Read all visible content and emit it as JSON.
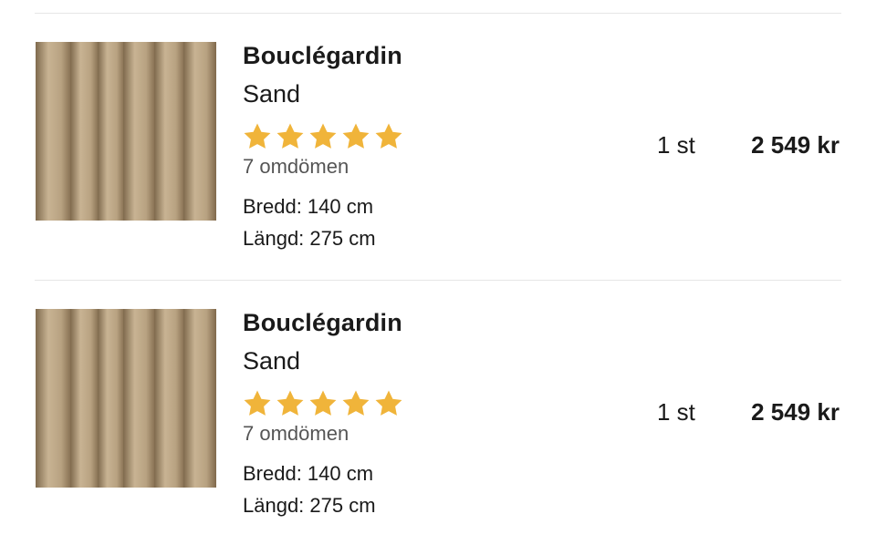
{
  "colors": {
    "star": "#f0b43a",
    "divider": "#e6e6e6",
    "text": "#1a1a1a",
    "muted": "#555555",
    "fabric": "#b39d7d"
  },
  "cart": {
    "items": [
      {
        "image_icon": "curtain-fabric-thumbnail",
        "name": "Bouclégardin",
        "variant": "Sand",
        "rating_stars": 5,
        "reviews": "7 omdömen",
        "width": "Bredd: 140 cm",
        "length": "Längd: 275 cm",
        "quantity": "1 st",
        "price": "2 549 kr"
      },
      {
        "image_icon": "curtain-fabric-thumbnail",
        "name": "Bouclégardin",
        "variant": "Sand",
        "rating_stars": 5,
        "reviews": "7 omdömen",
        "width": "Bredd: 140 cm",
        "length": "Längd: 275 cm",
        "quantity": "1 st",
        "price": "2 549 kr"
      }
    ]
  }
}
